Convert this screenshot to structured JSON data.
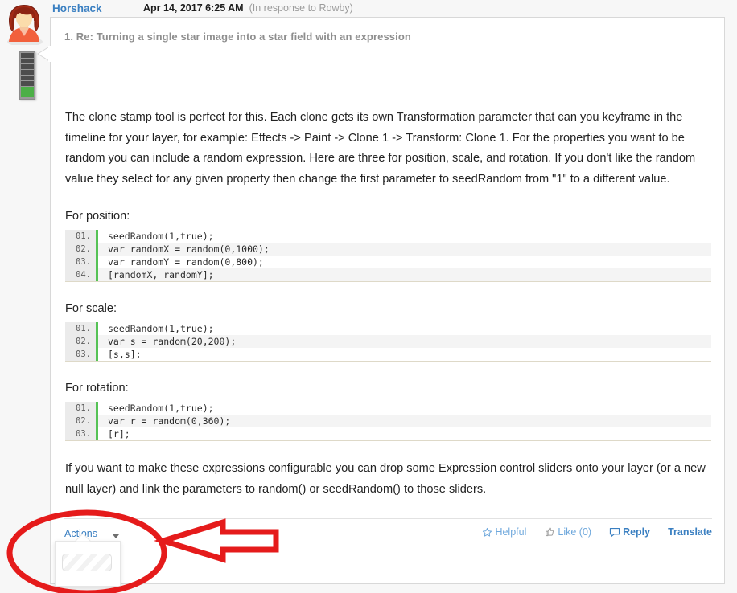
{
  "post": {
    "author": "Horshack",
    "date": "Apr 14, 2017 6:25 AM",
    "in_response_to": "(In response to Rowby)",
    "title": "1. Re: Turning a single star image into a star field with an expression",
    "paragraphs": [
      "The clone stamp tool is perfect for this. Each clone gets its own Transformation parameter that can you keyframe in the timeline for your layer, for example: Effects -> Paint -> Clone 1 -> Transform: Clone 1. For the properties you want to be random you can include a random expression. Here are three for position, scale, and rotation. If you don't like the random value they select for any given property then change the first parameter to seedRandom from \"1\" to a different value.",
      "If you want to make these expressions configurable you can drop some Expression control sliders onto your layer (or a new null layer) and link the parameters to random() or seedRandom() to those sliders."
    ],
    "code_sections": [
      {
        "label": "For position:",
        "lines": [
          {
            "num": "01.",
            "code": "seedRandom(1,true);"
          },
          {
            "num": "02.",
            "code": "var randomX = random(0,1000);"
          },
          {
            "num": "03.",
            "code": "var randomY = random(0,800);"
          },
          {
            "num": "04.",
            "code": "[randomX, randomY];"
          }
        ]
      },
      {
        "label": "For scale:",
        "lines": [
          {
            "num": "01.",
            "code": "seedRandom(1,true);"
          },
          {
            "num": "02.",
            "code": "var s = random(20,200);"
          },
          {
            "num": "03.",
            "code": "[s,s];"
          }
        ]
      },
      {
        "label": "For rotation:",
        "lines": [
          {
            "num": "01.",
            "code": "seedRandom(1,true);"
          },
          {
            "num": "02.",
            "code": "var r = random(0,360);"
          },
          {
            "num": "03.",
            "code": "[r];"
          }
        ]
      }
    ]
  },
  "footer": {
    "actions_label": "Actions",
    "helpful_label": "Helpful",
    "like_label": "Like (0)",
    "reply_label": "Reply",
    "translate_label": "Translate"
  },
  "avatar": {
    "rank_segments_total": 8,
    "rank_segments_filled": 2
  },
  "colors": {
    "link_blue": "#3a7fc1",
    "muted_blue": "#6fa8dc",
    "code_gutter_green": "#55c255",
    "annotation_red": "#e51b1b",
    "title_grey": "#8e8e8e",
    "rank_green": "#4caf47"
  }
}
